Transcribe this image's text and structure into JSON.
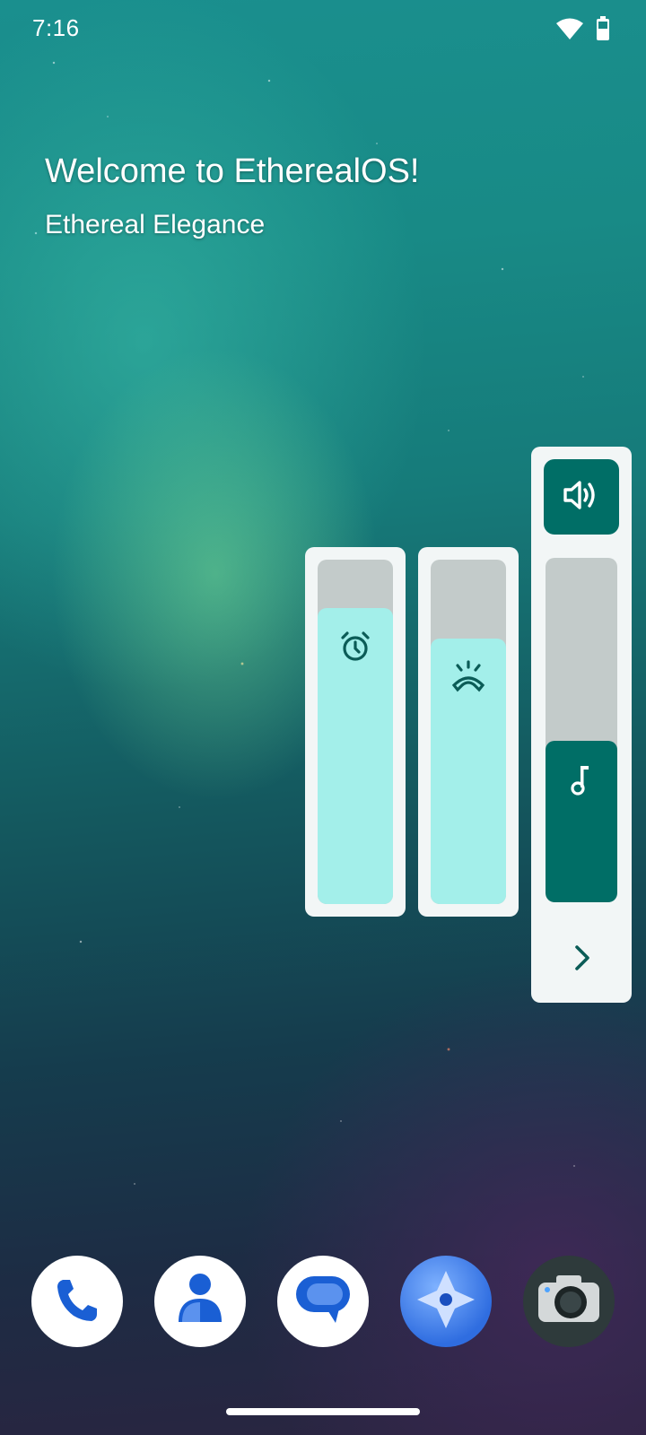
{
  "status_bar": {
    "time": "7:16",
    "icons": [
      "wifi-icon",
      "battery-icon"
    ]
  },
  "greeting": {
    "title": "Welcome to EtherealOS!",
    "subtitle": "Ethereal Elegance"
  },
  "volume_panel": {
    "sliders": [
      {
        "name": "alarm",
        "icon": "alarm-clock-icon",
        "level": 0.86
      },
      {
        "name": "call",
        "icon": "phone-ring-icon",
        "level": 0.77
      },
      {
        "name": "media",
        "icon": "music-note-icon",
        "level": 0.47
      }
    ],
    "speaker_icon": "speaker-icon",
    "expand_icon": "chevron-right-icon",
    "colors": {
      "accent_dark": "#006e66",
      "accent_light": "#a3efea",
      "track": "#c3cbca",
      "panel": "#f2f6f6"
    }
  },
  "dock": {
    "apps": [
      {
        "name": "phone",
        "icon": "phone-icon"
      },
      {
        "name": "contacts",
        "icon": "person-icon"
      },
      {
        "name": "messages",
        "icon": "chat-bubble-icon"
      },
      {
        "name": "launcher",
        "icon": "compass-icon"
      },
      {
        "name": "camera",
        "icon": "camera-icon"
      }
    ]
  }
}
